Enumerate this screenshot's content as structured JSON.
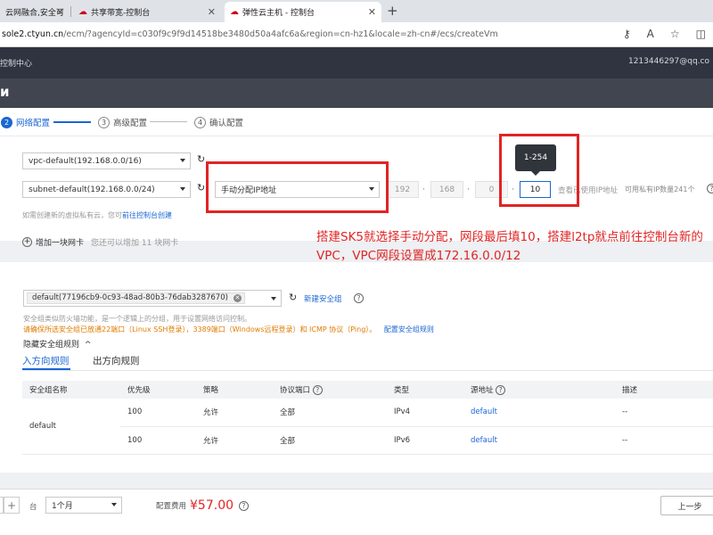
{
  "browser": {
    "tabs": [
      {
        "label": "云网融合,安全可"
      },
      {
        "label": "共享带宽-控制台"
      },
      {
        "label": "弹性云主机 - 控制台"
      }
    ],
    "url_host": "sole2.ctyun.cn",
    "url_rest": "/ecm/?agencyId=c030f9c9f9d14518be3480d50a4afc6a&region=cn-hz1&locale=zh-cn#/ecs/createVm"
  },
  "console": {
    "title": "控制中心",
    "account": "1213446297@qq.co",
    "page_title": "и"
  },
  "steps": [
    {
      "num": "2",
      "label": "网络配置"
    },
    {
      "num": "3",
      "label": "高级配置"
    },
    {
      "num": "4",
      "label": "确认配置"
    }
  ],
  "network": {
    "vpc_value": "vpc-default(192.168.0.0/16)",
    "subnet_value": "subnet-default(192.168.0.0/24)",
    "ip_mode_value": "手动分配IP地址",
    "ip_octets": [
      "192",
      "168",
      "0",
      "10"
    ],
    "view_used_ip": "查看已使用IP地址",
    "available_ip": "可用私有IP数量241个",
    "tooltip": "1-254",
    "create_hint": "如需创建新的虚拟私有云，您可",
    "create_link": "前往控制台创建",
    "add_nic_label": "增加一块网卡",
    "add_nic_hint": "您还可以增加 11 块网卡"
  },
  "annotation": "搭建SK5就选择手动分配，网段最后填10，搭建l2tp就点前往控制台新的VPC，VPC网段设置成172.16.0.0/12",
  "security": {
    "selected_group": "default(77196cb9-0c93-48ad-80b3-76dab3287670)",
    "new_group_link": "新建安全组",
    "desc": "安全组类似防火墙功能，是一个逻辑上的分组，用于设置网络访问控制。",
    "warning": "请确保所选安全组已放通22端口（Linux SSH登录），3389端口（Windows远程登录）和 ICMP 协议（Ping）。",
    "config_link": "配置安全组规则",
    "hide_rules": "隐藏安全组规则",
    "tab_inbound": "入方向规则",
    "tab_outbound": "出方向规则",
    "columns": [
      "安全组名称",
      "优先级",
      "策略",
      "协议端口",
      "类型",
      "源地址",
      "描述"
    ],
    "group_name": "default",
    "rows": [
      {
        "priority": "100",
        "policy": "允许",
        "port": "全部",
        "type": "IPv4",
        "source": "default",
        "desc": "--"
      },
      {
        "priority": "100",
        "policy": "允许",
        "port": "全部",
        "type": "IPv6",
        "source": "default",
        "desc": "--"
      }
    ]
  },
  "footer": {
    "unit": "台",
    "duration": "1个月",
    "fee_label": "配置费用",
    "fee_value": "¥57.00",
    "prev_button": "上一步"
  }
}
